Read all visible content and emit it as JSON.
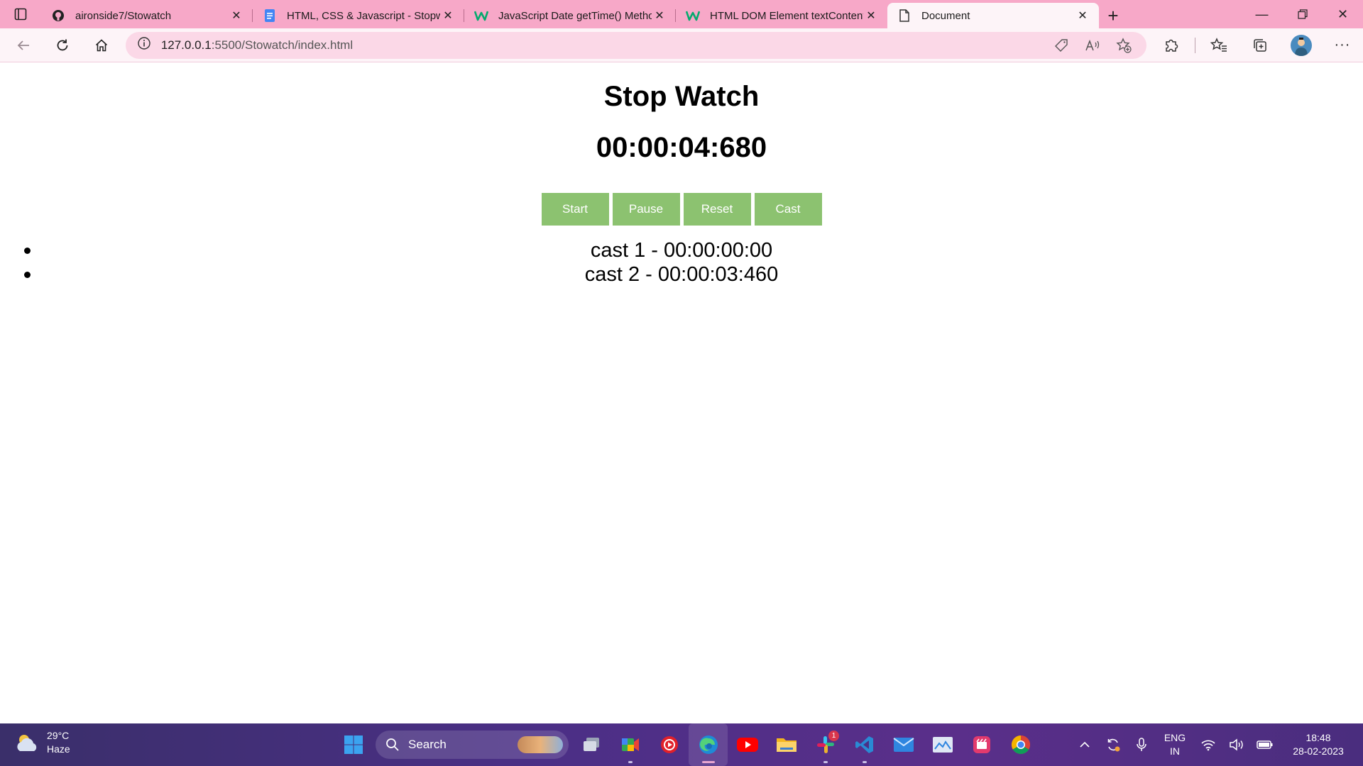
{
  "browser": {
    "tabs": [
      {
        "title": "aironside7/Stowatch",
        "favicon": "github-icon"
      },
      {
        "title": "HTML, CSS & Javascript - Stopwatch",
        "favicon": "docs-icon"
      },
      {
        "title": "JavaScript Date getTime() Method",
        "favicon": "w3schools-icon"
      },
      {
        "title": "HTML DOM Element textContent",
        "favicon": "w3schools-icon"
      },
      {
        "title": "Document",
        "favicon": "page-icon"
      }
    ],
    "active_tab": 4,
    "address": {
      "host": "127.0.0.1",
      "rest": ":5500/Stowatch/index.html"
    }
  },
  "page": {
    "heading": "Stop Watch",
    "timer": "00:00:04:680",
    "buttons": {
      "start": "Start",
      "pause": "Pause",
      "reset": "Reset",
      "cast": "Cast"
    },
    "casts": [
      {
        "text": "cast 1 - 00:00:00:00"
      },
      {
        "text": "cast 2 - 00:00:03:460"
      }
    ],
    "button_color": "#8cc270"
  },
  "taskbar": {
    "weather": {
      "temp": "29°C",
      "condition": "Haze"
    },
    "search_label": "Search",
    "slack_badge": "1",
    "lang": {
      "line1": "ENG",
      "line2": "IN"
    },
    "clock": {
      "time": "18:48",
      "date": "28-02-2023"
    }
  },
  "colors": {
    "tabbar": "#f7a8c8",
    "toolbar": "#fdf4f8",
    "address_bar": "#fbd8e7"
  }
}
